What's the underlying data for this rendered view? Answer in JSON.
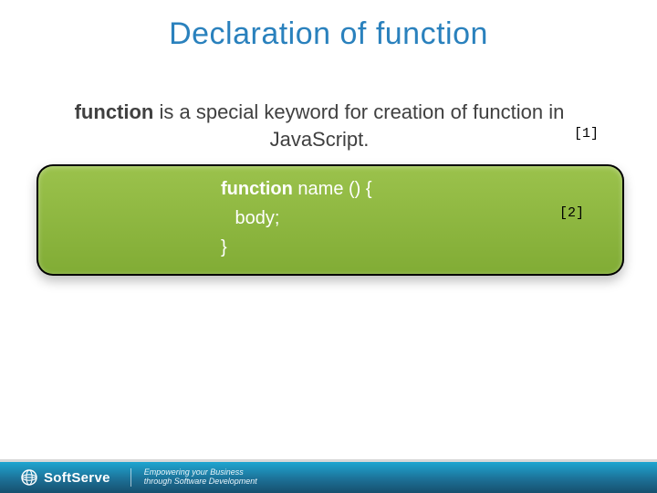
{
  "title": {
    "part1": "Declaration",
    "part2": "of function"
  },
  "description": {
    "keyword": "function",
    "text_after": " is a special keyword for creation of function in JavaScript."
  },
  "annotations": {
    "a1": "[1]",
    "a2": "[2]"
  },
  "code": {
    "line1_kw": "function",
    "line1_rest": " name () {",
    "line2": " body;",
    "line3": "}"
  },
  "footer": {
    "brand": "SoftServe",
    "tagline1": "Empowering your Business",
    "tagline2": "through Software Development"
  }
}
